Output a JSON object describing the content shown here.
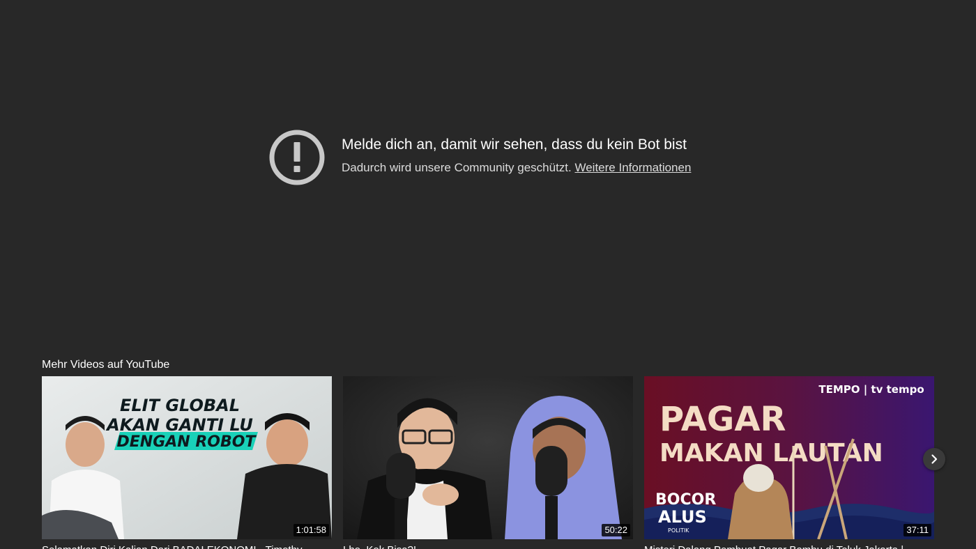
{
  "error": {
    "icon": "exclamation-circle-icon",
    "title": "Melde dich an, damit wir sehen, dass du kein Bot bist",
    "subtitle": "Dadurch wird unsere Community geschützt.",
    "link": "Weitere Informationen"
  },
  "more_videos": {
    "heading": "Mehr Videos auf YouTube",
    "next_icon": "chevron-right-icon",
    "videos": [
      {
        "title": "Selamatkan Diri Kalian Dari BADAI EKONOMI - Timothy",
        "duration": "1:01:58",
        "thumb_line1": "ELIT GLOBAL",
        "thumb_line2": "AKAN GANTI LU",
        "thumb_line3": "DENGAN ROBOT"
      },
      {
        "title": "Lho, Kok Bisa?!",
        "duration": "50:22"
      },
      {
        "title": "Misteri Dalang Pembuat Pagar Bambu di Teluk Jakarta |",
        "duration": "37:11",
        "thumb_brand": "TEMPO | tv tempo",
        "thumb_line1": "PAGAR",
        "thumb_line2": "MAKAN LAUTAN",
        "thumb_logo_line1": "BOCOR",
        "thumb_logo_line2": "ALUS",
        "thumb_logo_line3": "POLITIK"
      }
    ]
  }
}
